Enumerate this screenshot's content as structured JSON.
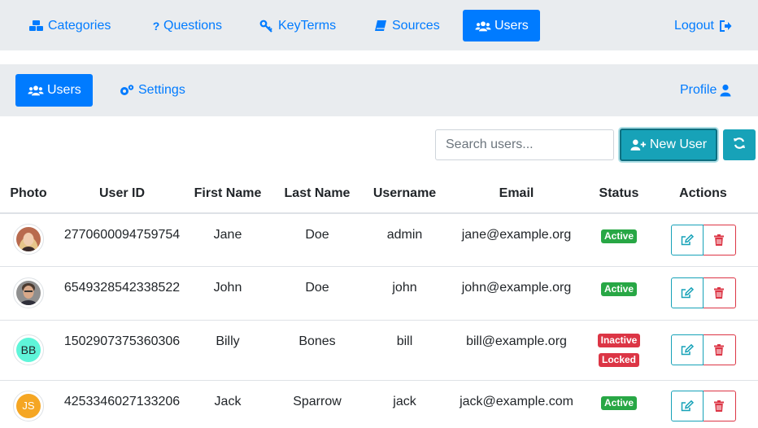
{
  "topnav": {
    "items": [
      {
        "label": "Categories",
        "icon": "cubes-icon"
      },
      {
        "label": "Questions",
        "icon": "question-icon"
      },
      {
        "label": "KeyTerms",
        "icon": "key-icon"
      },
      {
        "label": "Sources",
        "icon": "book-icon"
      },
      {
        "label": "Users",
        "icon": "users-icon",
        "active": true
      }
    ],
    "logout": {
      "label": "Logout",
      "icon": "sign-out-icon"
    }
  },
  "subnav": {
    "items": [
      {
        "label": "Users",
        "icon": "users-icon",
        "active": true
      },
      {
        "label": "Settings",
        "icon": "cogs-icon"
      }
    ],
    "profile": {
      "label": "Profile",
      "icon": "user-icon"
    }
  },
  "toolbar": {
    "search_placeholder": "Search users...",
    "new_user_label": "New User"
  },
  "table": {
    "headers": [
      "Photo",
      "User ID",
      "First Name",
      "Last Name",
      "Username",
      "Email",
      "Status",
      "Actions"
    ],
    "rows": [
      {
        "user_id": "2770600094759754",
        "first": "Jane",
        "last": "Doe",
        "username": "admin",
        "email": "jane@example.org",
        "photo": "photo",
        "status": [
          "Active"
        ]
      },
      {
        "user_id": "6549328542338522",
        "first": "John",
        "last": "Doe",
        "username": "john",
        "email": "john@example.org",
        "photo": "photo",
        "status": [
          "Active"
        ]
      },
      {
        "user_id": "1502907375360306",
        "first": "Billy",
        "last": "Bones",
        "username": "bill",
        "email": "bill@example.org",
        "initials": "BB",
        "status": [
          "Inactive",
          "Locked"
        ]
      },
      {
        "user_id": "4253346027133206",
        "first": "Jack",
        "last": "Sparrow",
        "username": "jack",
        "email": "jack@example.com",
        "initials": "JS",
        "status": [
          "Active"
        ]
      }
    ]
  },
  "colors": {
    "primary": "#007bff",
    "info": "#17a2b8",
    "success": "#28a745",
    "danger": "#dc3545",
    "nav_bg": "#e9ecef",
    "avatar_bb": "#5ff5d9",
    "avatar_js": "#f5a623"
  }
}
